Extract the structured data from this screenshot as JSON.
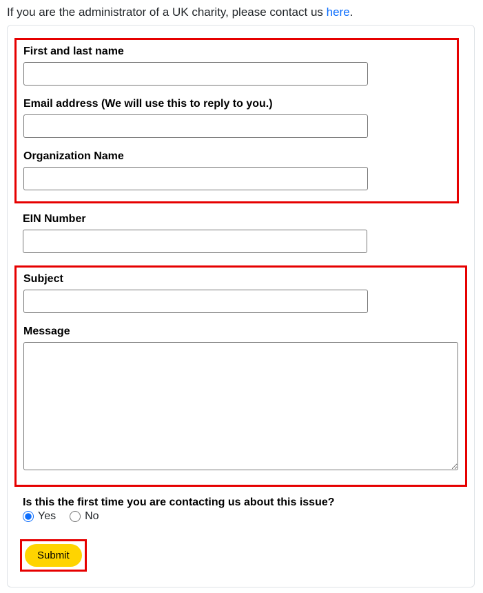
{
  "intro": {
    "text_before": "If you are the administrator of a UK charity, please contact us ",
    "link_text": "here",
    "text_after": "."
  },
  "fields": {
    "name": {
      "label": "First and last name",
      "value": ""
    },
    "email": {
      "label": "Email address (We will use this to reply to you.)",
      "value": ""
    },
    "org": {
      "label": "Organization Name",
      "value": ""
    },
    "ein": {
      "label": "EIN Number",
      "value": ""
    },
    "subject": {
      "label": "Subject",
      "value": ""
    },
    "message": {
      "label": "Message",
      "value": ""
    }
  },
  "first_contact": {
    "label": "Is this the first time you are contacting us about this issue?",
    "yes": "Yes",
    "no": "No",
    "selected": "yes"
  },
  "submit": {
    "label": "Submit"
  }
}
